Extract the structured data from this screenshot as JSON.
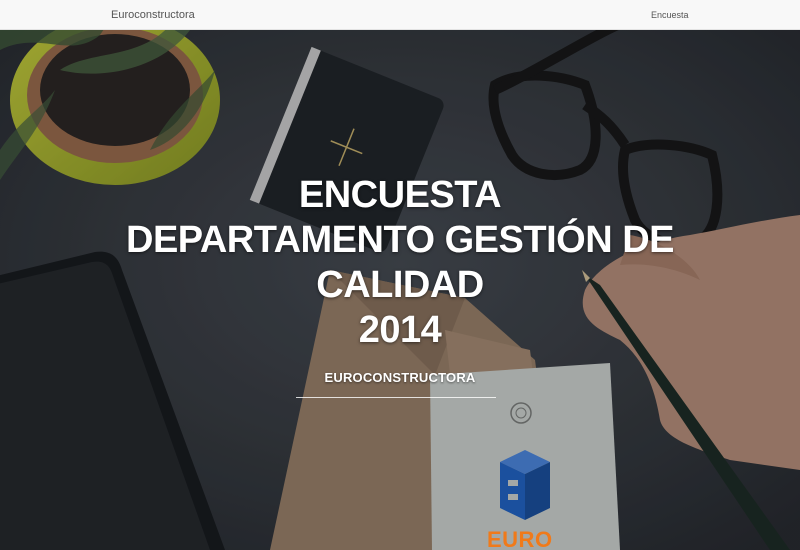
{
  "navbar": {
    "brand": "Euroconstructora",
    "link_encuesta": "Encuesta"
  },
  "hero": {
    "title_lines": [
      "ENCUESTA",
      "DEPARTAMENTO GESTIÓN DE",
      "CALIDAD",
      "2014"
    ],
    "subtitle": "EUROCONSTRUCTORA",
    "logo_text": "EURO"
  },
  "colors": {
    "navbar_bg": "#f8f8f8",
    "hero_text": "#ffffff",
    "logo_orange": "#f07a1a",
    "logo_blue": "#1f63c6"
  }
}
